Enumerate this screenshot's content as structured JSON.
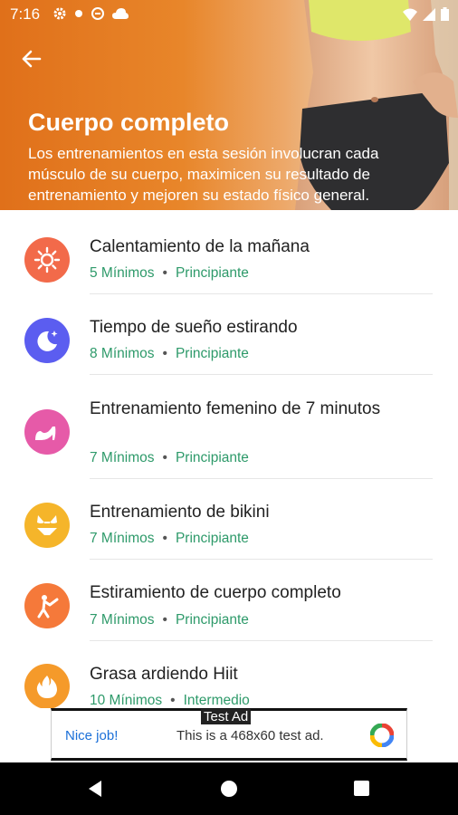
{
  "status_bar": {
    "time": "7:16"
  },
  "header": {
    "title": "Cuerpo completo",
    "description": "Los entrenamientos en esta sesión involucran cada músculo de su cuerpo, maximicen su resultado de entrenamiento y mejoren su estado físico general."
  },
  "workouts": [
    {
      "name": "Calentamiento de la mañana",
      "duration": "5 Mínimos",
      "level": "Principiante",
      "icon": "sun-icon",
      "color": "#f26a4a"
    },
    {
      "name": "Tiempo de sueño estirando",
      "duration": "8 Mínimos",
      "level": "Principiante",
      "icon": "moon-icon",
      "color": "#5b5df0"
    },
    {
      "name": "Entrenamiento femenino de 7 minutos",
      "duration": "7 Mínimos",
      "level": "Principiante",
      "icon": "high-heel-icon",
      "color": "#e65aa8"
    },
    {
      "name": "Entrenamiento de bikini",
      "duration": "7 Mínimos",
      "level": "Principiante",
      "icon": "bikini-icon",
      "color": "#f5b52a"
    },
    {
      "name": "Estiramiento de cuerpo completo",
      "duration": "7 Mínimos",
      "level": "Principiante",
      "icon": "stretch-icon",
      "color": "#f5793a"
    },
    {
      "name": "Grasa ardiendo Hiit",
      "duration": "10 Mínimos",
      "level": "Intermedio",
      "icon": "flame-icon",
      "color": "#f59a2a"
    }
  ],
  "meta_separator": "•",
  "ad": {
    "tag": "Test Ad",
    "nice_job": "Nice job!",
    "text": "This is a 468x60 test ad."
  }
}
